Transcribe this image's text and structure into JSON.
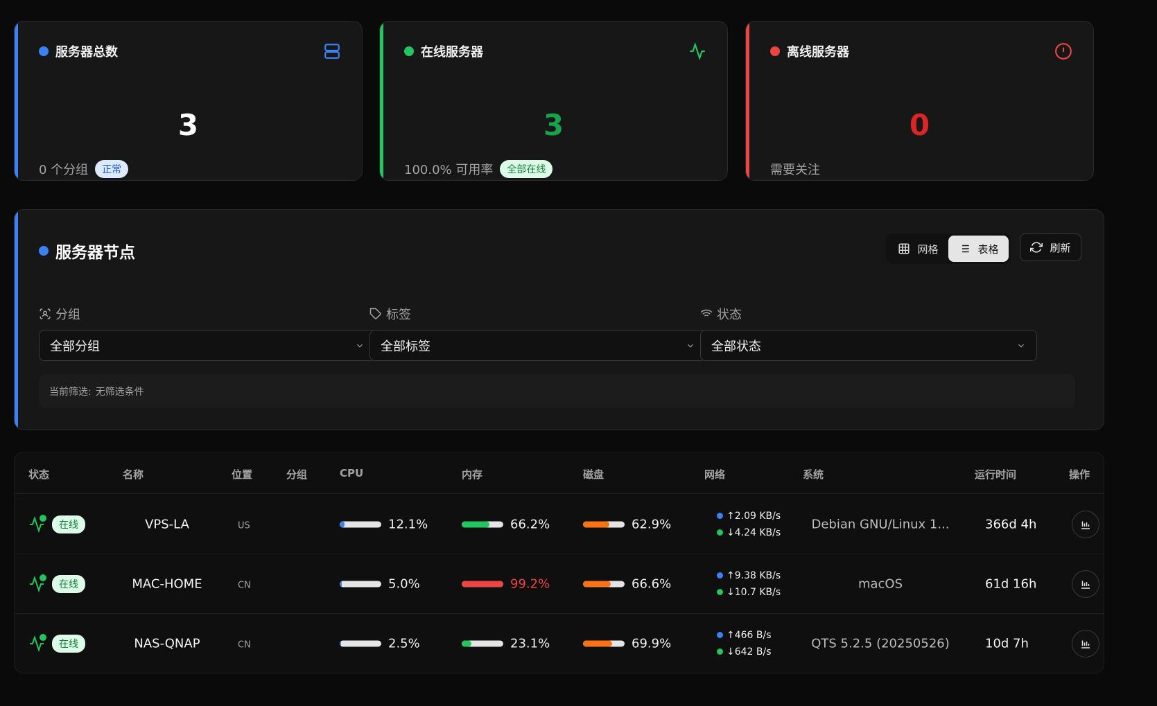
{
  "stats": {
    "total": {
      "title": "服务器总数",
      "value": "3",
      "footer": "0 个分组",
      "badge": "正常",
      "accent": "#3b82f6"
    },
    "online": {
      "title": "在线服务器",
      "value": "3",
      "footer": "100.0% 可用率",
      "badge": "全部在线",
      "accent": "#22c55e"
    },
    "offline": {
      "title": "离线服务器",
      "value": "0",
      "footer": "需要关注",
      "accent": "#ef4444"
    }
  },
  "nodes_panel": {
    "title": "服务器节点",
    "view_grid": "网格",
    "view_table": "表格",
    "refresh": "刷新",
    "filters": {
      "group": {
        "label": "分组",
        "value": "全部分组"
      },
      "tag": {
        "label": "标签",
        "value": "全部标签"
      },
      "status": {
        "label": "状态",
        "value": "全部状态"
      }
    },
    "current_filter_label": "当前筛选:",
    "current_filter_value": "无筛选条件"
  },
  "table": {
    "headers": {
      "status": "状态",
      "name": "名称",
      "location": "位置",
      "group": "分组",
      "cpu": "CPU",
      "memory": "内存",
      "disk": "磁盘",
      "network": "网络",
      "os": "系统",
      "uptime": "运行时间",
      "action": "操作"
    },
    "rows": [
      {
        "status": "在线",
        "name": "VPS-LA",
        "location": "US",
        "cpu": "12.1%",
        "cpu_pct": 12.1,
        "mem": "66.2%",
        "mem_pct": 66.2,
        "disk": "62.9%",
        "disk_pct": 62.9,
        "net_up": "↑2.09 KB/s",
        "net_down": "↓4.24 KB/s",
        "os": "Debian GNU/Linux 1...",
        "uptime": "366d 4h"
      },
      {
        "status": "在线",
        "name": "MAC-HOME",
        "location": "CN",
        "cpu": "5.0%",
        "cpu_pct": 5.0,
        "mem": "99.2%",
        "mem_pct": 99.2,
        "disk": "66.6%",
        "disk_pct": 66.6,
        "net_up": "↑9.38 KB/s",
        "net_down": "↓10.7 KB/s",
        "os": "macOS",
        "uptime": "61d 16h"
      },
      {
        "status": "在线",
        "name": "NAS-QNAP",
        "location": "CN",
        "cpu": "2.5%",
        "cpu_pct": 2.5,
        "mem": "23.1%",
        "mem_pct": 23.1,
        "disk": "69.9%",
        "disk_pct": 69.9,
        "net_up": "↑466 B/s",
        "net_down": "↓642 B/s",
        "os": "QTS 5.2.5 (20250526)",
        "uptime": "10d 7h"
      }
    ]
  },
  "colors": {
    "cpu": "#3b82f6",
    "mem_ok": "#22c55e",
    "mem_critical": "#ef4444",
    "disk": "#f97316",
    "net_up": "#3b82f6",
    "net_down": "#22c55e"
  }
}
